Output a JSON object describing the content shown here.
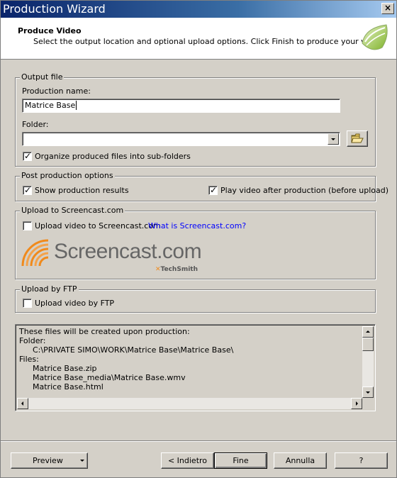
{
  "window": {
    "title": "Production Wizard",
    "close_glyph": "×"
  },
  "header": {
    "title": "Produce Video",
    "subtitle": "Select the output location and optional upload options. Click Finish to produce your video."
  },
  "output_file": {
    "group_label": "Output file",
    "production_name_label": "Production name:",
    "production_name_value": "Matrice Base",
    "folder_label": "Folder:",
    "folder_value": "",
    "organize_label": "Organize produced files into sub-folders",
    "organize_checked": true
  },
  "post_production": {
    "group_label": "Post production options",
    "show_results_label": "Show production results",
    "show_results_checked": true,
    "play_video_label": "Play video after production (before upload)",
    "play_video_checked": true
  },
  "screencast": {
    "group_label": "Upload to Screencast.com",
    "upload_label": "Upload video to Screencast.com",
    "upload_checked": false,
    "link_text": "What is Screencast.com?",
    "brand_text": "Screencast.com",
    "brand_sub": "TechSmith"
  },
  "ftp": {
    "group_label": "Upload by FTP",
    "upload_label": "Upload video by FTP",
    "upload_checked": false
  },
  "info": {
    "lines": [
      "These files will be created upon production:",
      "Folder:",
      "C:\\PRIVATE SIMO\\WORK\\Matrice Base\\Matrice Base\\",
      "Files:",
      "Matrice Base.zip",
      "Matrice Base_media\\Matrice Base.wmv",
      "Matrice Base.html"
    ]
  },
  "buttons": {
    "preview": "Preview",
    "back": "< Indietro",
    "finish": "Fine",
    "cancel": "Annulla",
    "help": "?"
  },
  "colors": {
    "titlebar_start": "#0a246a",
    "titlebar_end": "#a6caf0",
    "link": "#0000ff",
    "screencast_orange": "#f08a1c"
  },
  "icons": {
    "folder_browse": "folder-open-icon",
    "logo": "camtasia-logo-icon",
    "screencast_logo": "screencast-logo-icon"
  }
}
